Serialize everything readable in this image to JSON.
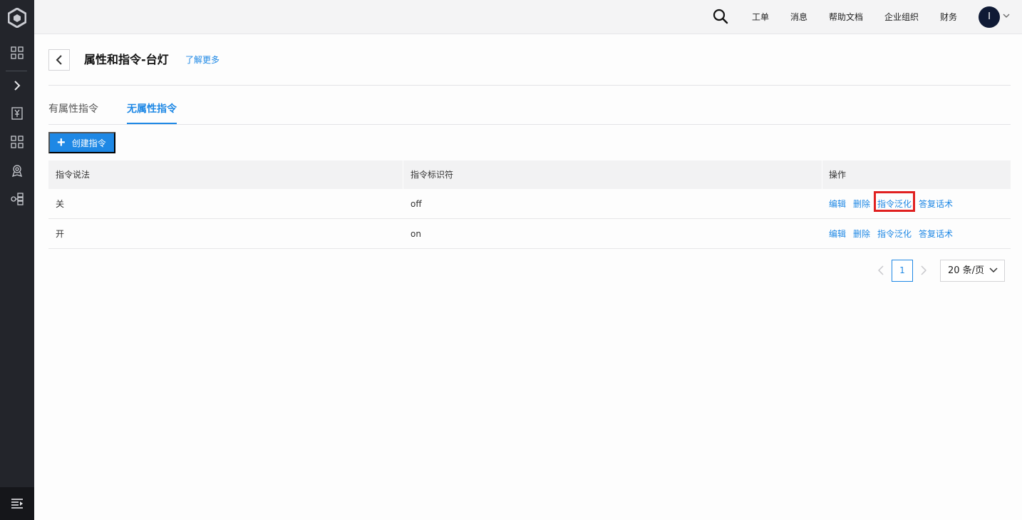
{
  "sidebar": {
    "icons": [
      "logo-icon",
      "grid-icon",
      "chevron-right-icon",
      "bookmark-icon",
      "apps-icon",
      "badge-icon",
      "network-icon",
      "menu-icon"
    ]
  },
  "topbar": {
    "links": [
      "工单",
      "消息",
      "帮助文档",
      "企业组织",
      "财务"
    ],
    "avatar_letter": "I"
  },
  "page": {
    "title": "属性和指令-台灯",
    "learn_more": "了解更多"
  },
  "tabs": [
    {
      "label": "有属性指令",
      "active": false
    },
    {
      "label": "无属性指令",
      "active": true
    }
  ],
  "toolbar": {
    "create_label": "创建指令"
  },
  "table": {
    "headers": [
      "指令说法",
      "指令标识符",
      "操作"
    ],
    "rows": [
      {
        "phrase": "关",
        "identifier": "off",
        "actions": [
          "编辑",
          "删除",
          "指令泛化",
          "答复话术"
        ]
      },
      {
        "phrase": "开",
        "identifier": "on",
        "actions": [
          "编辑",
          "删除",
          "指令泛化",
          "答复话术"
        ]
      }
    ]
  },
  "pagination": {
    "current_page": "1",
    "page_size": "20 条/页"
  },
  "colors": {
    "accent": "#1e88e5",
    "sidebar": "#23252b",
    "highlight": "#e02020"
  }
}
